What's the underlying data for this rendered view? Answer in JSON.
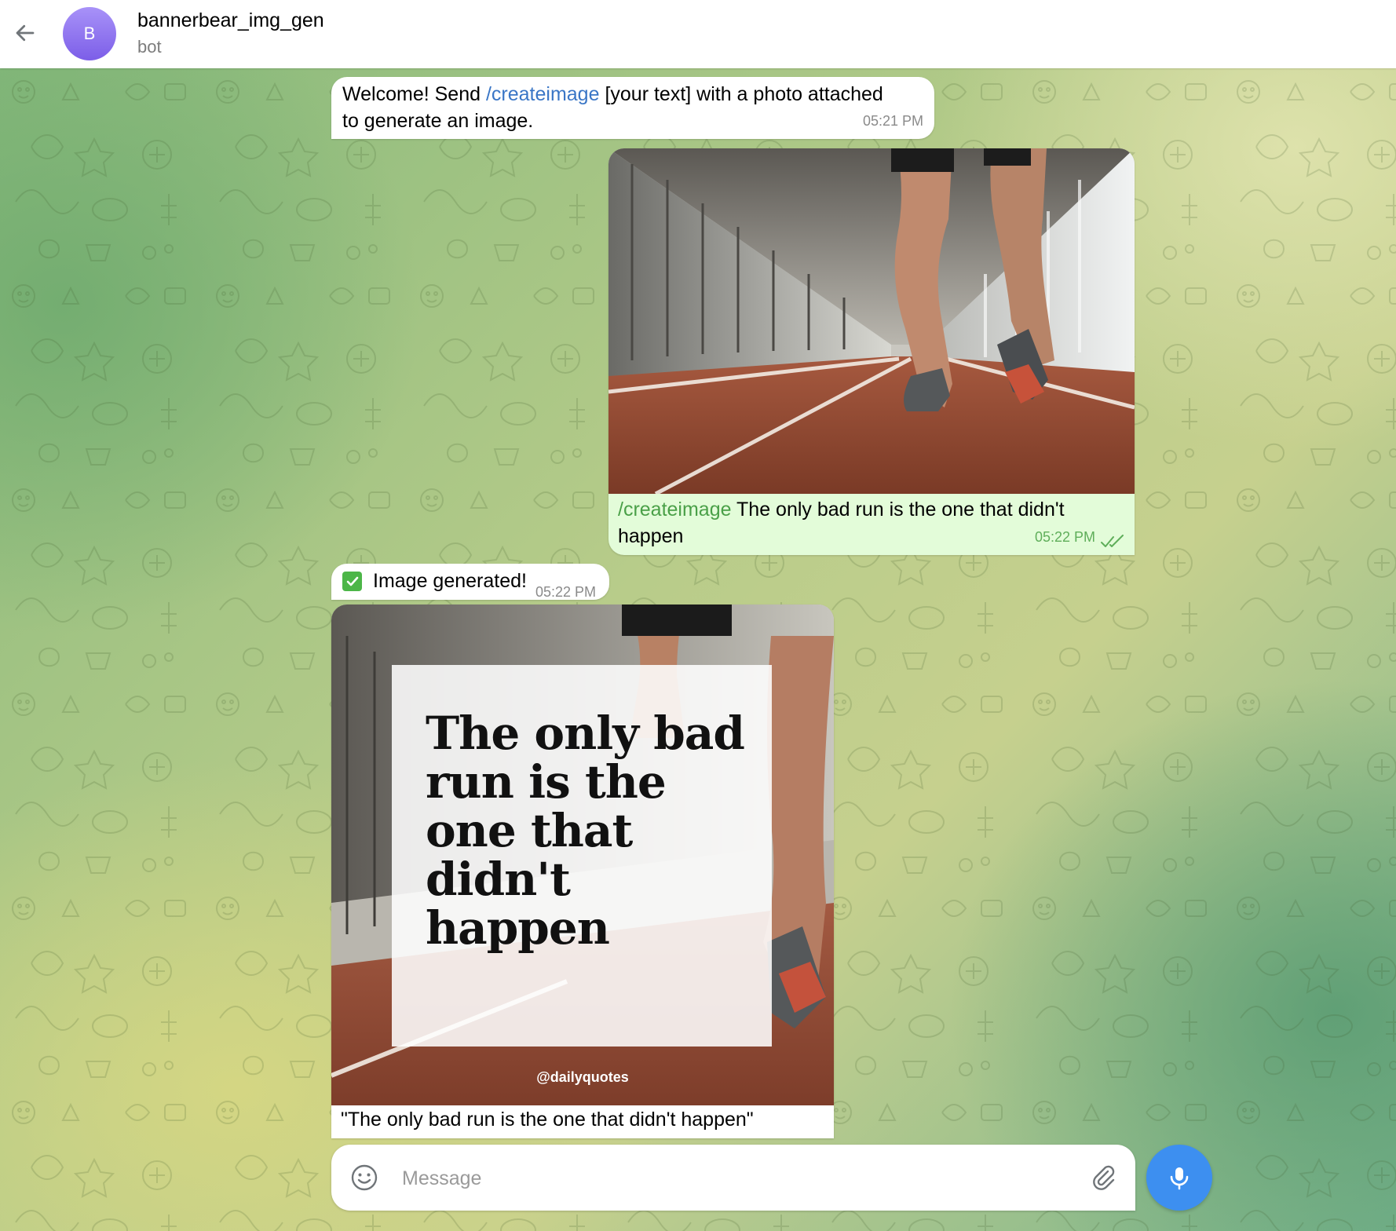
{
  "header": {
    "back_icon": "arrow-left-icon",
    "avatar_letter": "B",
    "avatar_color": "#8b6ff0",
    "title": "bannerbear_img_gen",
    "status": "bot"
  },
  "messages": {
    "welcome": {
      "text_before": "Welcome! Send ",
      "command": "/createimage",
      "text_after": " [your text] with a photo attached to generate an image.",
      "time": "05:21 PM"
    },
    "photo_message": {
      "command": "/createimage",
      "caption": " The only bad run is the one that didn't happen",
      "time": "05:22 PM",
      "status_icon": "double-check-icon"
    },
    "generated_notice": {
      "icon": "check-mark-icon",
      "text": "Image generated!",
      "time": "05:22 PM"
    },
    "result_image": {
      "quote": "The only bad run is the one that didn't happen",
      "handle": "@dailyquotes",
      "caption": "\"The only bad run is the one that didn't happen\""
    }
  },
  "composer": {
    "placeholder": "Message",
    "emoji_icon": "smile-icon",
    "attach_icon": "paperclip-icon",
    "mic_icon": "microphone-icon",
    "accent_color": "#3d8ff0"
  },
  "colors": {
    "incoming_bubble": "#ffffff",
    "outgoing_bubble": "#e3fcd9",
    "command_link": "#3a76c6"
  }
}
